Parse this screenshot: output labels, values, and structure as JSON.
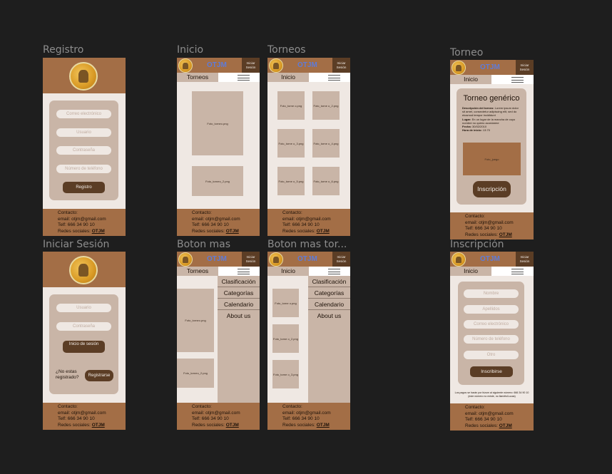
{
  "frames": {
    "registro": "Registro",
    "inicio": "Inicio",
    "torneos": "Torneos",
    "torneo": "Torneo",
    "iniciar_sesion": "Iniciar Sesión",
    "boton_mas": "Boton mas",
    "boton_mas_tor": "Boton mas tor...",
    "inscripcion": "Inscripción"
  },
  "brand": "OTJM",
  "login_btn": "Iniciar Sesión",
  "tabs": {
    "torneos": "Torneos",
    "inicio": "Inicio"
  },
  "footer": {
    "contacto": "Contacto:",
    "email": "email: otjm@gmail.com",
    "telf": "Telf: 666 34 90 10",
    "redes": "Redes sociales:",
    "redes_link": "OTJM"
  },
  "registro": {
    "email_ph": "Correo electrónico",
    "user_ph": "Usuario",
    "pass_ph": "Contraseña",
    "phone_ph": "Número de teléfono",
    "button": "Registro"
  },
  "login": {
    "user_ph": "Usuario",
    "pass_ph": "Contraseña",
    "button": "Inicio de sesión",
    "question": "¿No estas registrado?",
    "register_btn": "Registrarse"
  },
  "inicio_imgs": [
    "Foto_torneo.png",
    "Foto_torneo_2.png"
  ],
  "torneos_imgs": [
    "Foto_torne o.png",
    "Foto_torne o_2.png",
    "Foto_torne o_3.png",
    "Foto_torne o_4.png",
    "Foto_torne o_5.png",
    "Foto_torne o_6.png"
  ],
  "menu": [
    "Clasificación",
    "Categorías",
    "Calendario",
    "About us"
  ],
  "boton_mas_imgs": [
    "Foto_torneo.png",
    "Foto_torneo_2.png"
  ],
  "boton_mas_tor_imgs": [
    "Foto_torne o.png",
    "Foto_torne o_2.png",
    "Foto_torne o_3.png"
  ],
  "torneo": {
    "title": "Torneo genérico",
    "desc_label": "Descripción del torneo:",
    "desc": "Lorem ipsum dolor sit amet, consectetur adipiscing elit, sed do eiusmod tempor incididunt",
    "lugar_label": "Lugar:",
    "lugar": "En un lugar de la mancha de cuyo nombre no quiero acordarme",
    "fecha_label": "Fecha:",
    "fecha": "30/02/2010",
    "hora_label": "Hora de inicio:",
    "hora": "13:70",
    "img": "Foto_juego",
    "button": "Inscripción"
  },
  "inscripcion": {
    "name_ph": "Nombre",
    "surname_ph": "Apellidos",
    "email_ph": "Correo electrónico",
    "phone_ph": "Número de teléfono",
    "otro_ph": "Otro",
    "button": "Inscribirse",
    "note": "Los pagos se harán por bizum al siguiente número: 666 34 90 10 (este número no existe, no llaméis/Lucas)"
  }
}
